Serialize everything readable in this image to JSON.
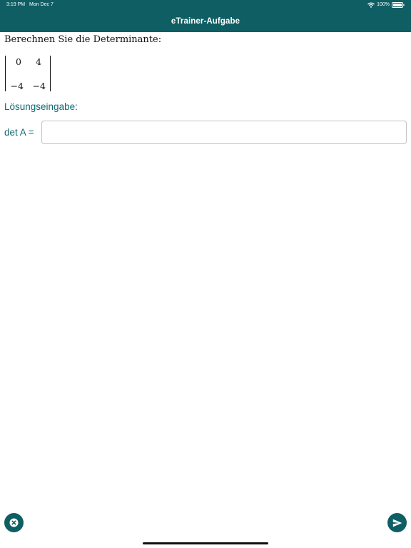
{
  "status_bar": {
    "time": "3:19 PM",
    "date": "Mon Dec 7",
    "battery_percent": "100%"
  },
  "header": {
    "title": "eTrainer-Aufgabe"
  },
  "task": {
    "prompt": "Berechnen Sie die Determinante:",
    "matrix": [
      [
        "0",
        "4"
      ],
      [
        "−4",
        "−4"
      ]
    ]
  },
  "answer": {
    "section_label": "Lösungseingabe:",
    "field_label": "det A =",
    "value": "",
    "placeholder": ""
  },
  "actions": {
    "cancel_icon": "close-circle-icon",
    "submit_icon": "send-icon"
  },
  "colors": {
    "accent": "#0f5e63",
    "label_text": "#0f6b6f",
    "background": "#ffffff"
  }
}
